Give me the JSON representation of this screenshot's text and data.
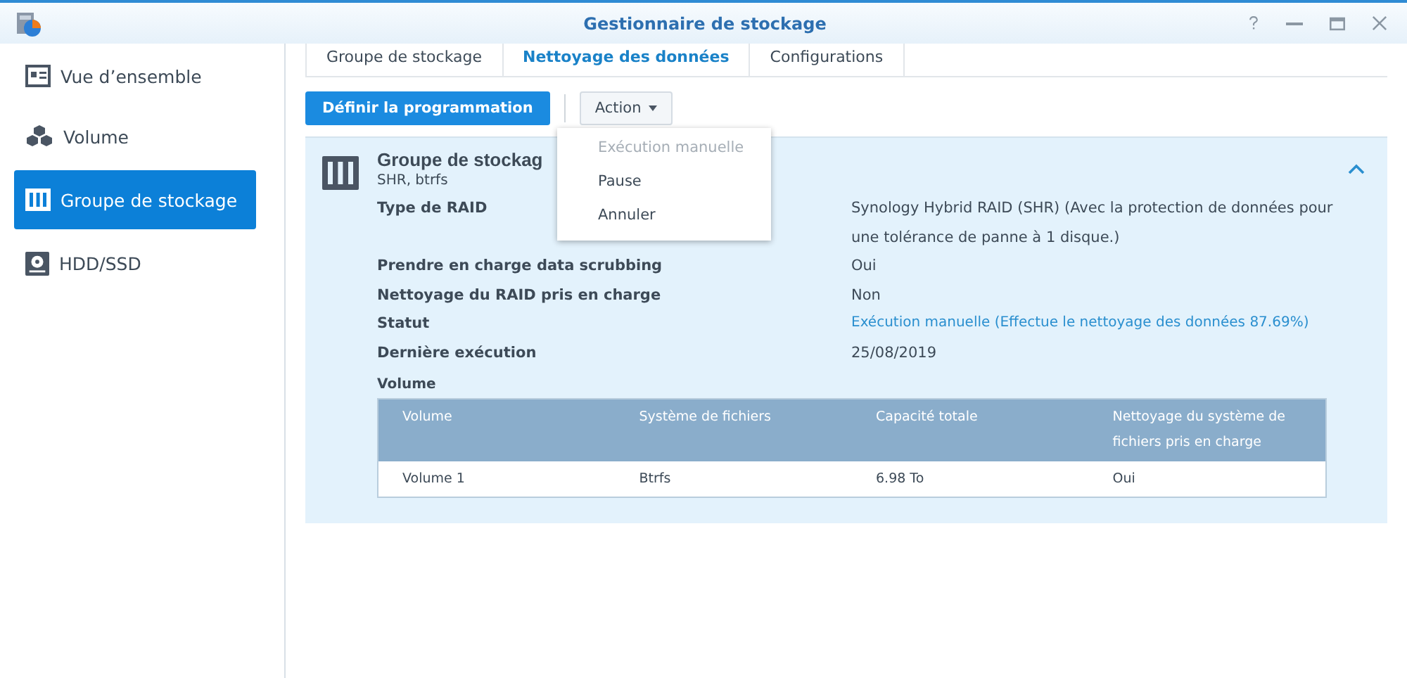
{
  "window": {
    "title": "Gestionnaire de stockage"
  },
  "sidebar": {
    "items": [
      {
        "label": "Vue d’ensemble",
        "kind": "overview",
        "selected": false
      },
      {
        "label": "Volume",
        "kind": "volume",
        "selected": false
      },
      {
        "label": "Groupe de stockage",
        "kind": "pool",
        "selected": true
      },
      {
        "label": "HDD/SSD",
        "kind": "disk",
        "selected": false
      }
    ]
  },
  "tabs": [
    {
      "label": "Groupe de stockage",
      "selected": false
    },
    {
      "label": "Nettoyage des données",
      "selected": true
    },
    {
      "label": "Configurations",
      "selected": false
    }
  ],
  "toolbar": {
    "primary_button": "Définir la programmation",
    "action_button": "Action"
  },
  "action_menu": [
    {
      "label": "Exécution manuelle",
      "disabled": true
    },
    {
      "label": "Pause",
      "disabled": false
    },
    {
      "label": "Annuler",
      "disabled": false
    }
  ],
  "panel": {
    "title": "Groupe de stockag",
    "subtitle": "SHR, btrfs",
    "expanded": true,
    "properties": [
      {
        "label": "Type de RAID",
        "value": "Synology Hybrid RAID (SHR) (Avec la protection de données pour une tolérance de panne à 1 disque.)",
        "kind": "text"
      },
      {
        "label": "Prendre en charge data scrubbing",
        "value": "Oui",
        "kind": "text"
      },
      {
        "label": "Nettoyage du RAID pris en charge",
        "value": "Non",
        "kind": "text"
      },
      {
        "label": "Statut",
        "value": "Exécution manuelle (Effectue le nettoyage des données 87.69%)",
        "kind": "status"
      },
      {
        "label": "Dernière exécution",
        "value": "25/08/2019",
        "kind": "text"
      }
    ],
    "volume_section": {
      "title": "Volume",
      "columns": [
        "Volume",
        "Système de fichiers",
        "Capacité totale",
        "Nettoyage du système de fichiers pris en charge"
      ],
      "rows": [
        [
          "Volume 1",
          "Btrfs",
          "6.98 To",
          "Oui"
        ]
      ]
    }
  }
}
